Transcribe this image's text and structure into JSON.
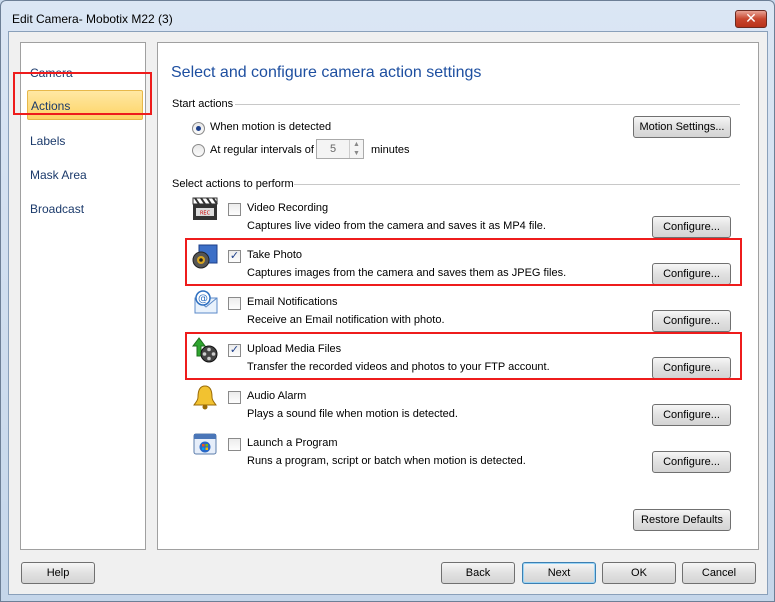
{
  "window": {
    "title": "Edit Camera- Mobotix M22 (3)",
    "close_label": "✕"
  },
  "nav": {
    "items": [
      {
        "label": "Camera"
      },
      {
        "label": "Actions",
        "selected": true
      },
      {
        "label": "Labels"
      },
      {
        "label": "Mask Area"
      },
      {
        "label": "Broadcast"
      }
    ]
  },
  "main": {
    "title": "Select and configure camera action settings",
    "start_actions": {
      "label": "Start actions",
      "option_motion": "When motion is detected",
      "option_interval": "At regular intervals of",
      "interval_value": "5",
      "interval_unit": "minutes",
      "motion_settings_label": "Motion Settings..."
    },
    "actions_label": "Select actions to perform",
    "actions": [
      {
        "name": "Video Recording",
        "description": "Captures live video from the camera and saves it as MP4 file.",
        "checked": false,
        "icon": "video-recording-icon"
      },
      {
        "name": "Take Photo",
        "description": "Captures images from the camera and saves them as JPEG files.",
        "checked": true,
        "icon": "camera-photo-icon"
      },
      {
        "name": "Email Notifications",
        "description": "Receive an Email notification with photo.",
        "checked": false,
        "icon": "email-icon"
      },
      {
        "name": "Upload Media Files",
        "description": "Transfer the recorded videos and photos to your FTP account.",
        "checked": true,
        "icon": "upload-icon"
      },
      {
        "name": "Audio Alarm",
        "description": "Plays a sound file when motion is detected.",
        "checked": false,
        "icon": "bell-icon"
      },
      {
        "name": "Launch a Program",
        "description": "Runs a program, script or batch when motion is detected.",
        "checked": false,
        "icon": "program-icon"
      }
    ],
    "configure_label": "Configure...",
    "restore_defaults_label": "Restore Defaults"
  },
  "footer": {
    "help": "Help",
    "back": "Back",
    "next": "Next",
    "ok": "OK",
    "cancel": "Cancel"
  },
  "colors": {
    "highlight_box": "#ee1c1c",
    "title_blue": "#1e4fa0",
    "selected_nav": "#fdd465"
  }
}
